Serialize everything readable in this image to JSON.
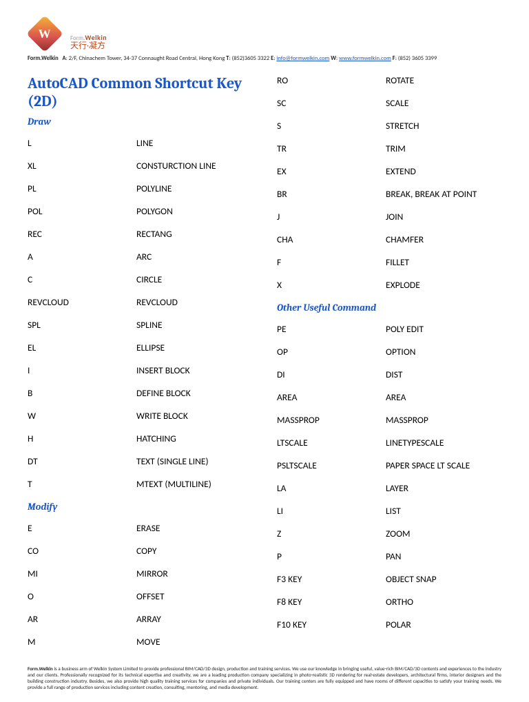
{
  "brand": {
    "company": "Form.Welkin",
    "logo_text_top": "Form.",
    "logo_text_mid": "Welkin",
    "logo_text_cn": "天行·凝方"
  },
  "address_line": {
    "pre": "Form.Welkin",
    "a_label": "A",
    "a": ": 2/F, Chinachem Tower, 34-37 Connaught Road Central, Hong Kong ",
    "t_label": "T",
    "t": ": (852)3605 3322 ",
    "e_label": "E",
    "e_pre": ": ",
    "e_link": "info@formwelkin.com",
    "w_label": " W",
    "w_pre": ": ",
    "w_link": "www.formwelkin.com",
    "f_label": " F",
    "f": ": (852) 3605 3399"
  },
  "title": "AutoCAD Common Shortcut Key (2D)",
  "sections": {
    "draw": "Draw",
    "modify": "Modify",
    "other": "Other Useful Command"
  },
  "draw": [
    {
      "k": "L",
      "v": "LINE"
    },
    {
      "k": "XL",
      "v": "CONSTURCTION LINE"
    },
    {
      "k": "PL",
      "v": "POLYLINE"
    },
    {
      "k": "POL",
      "v": "POLYGON"
    },
    {
      "k": "REC",
      "v": "RECTANG"
    },
    {
      "k": "A",
      "v": "ARC"
    },
    {
      "k": "C",
      "v": "CIRCLE"
    },
    {
      "k": "REVCLOUD",
      "v": "REVCLOUD"
    },
    {
      "k": "SPL",
      "v": "SPLINE"
    },
    {
      "k": "EL",
      "v": "ELLIPSE"
    },
    {
      "k": "I",
      "v": "INSERT BLOCK"
    },
    {
      "k": "B",
      "v": "DEFINE BLOCK"
    },
    {
      "k": "W",
      "v": "WRITE BLOCK"
    },
    {
      "k": "H",
      "v": "HATCHING"
    },
    {
      "k": "DT",
      "v": "TEXT (SINGLE LINE)"
    },
    {
      "k": "T",
      "v": "MTEXT (MULTILINE)"
    }
  ],
  "modify": [
    {
      "k": "E",
      "v": "ERASE"
    },
    {
      "k": "CO",
      "v": "COPY"
    },
    {
      "k": "MI",
      "v": "MIRROR"
    },
    {
      "k": "O",
      "v": "OFFSET"
    },
    {
      "k": "AR",
      "v": "ARRAY"
    },
    {
      "k": "M",
      "v": "MOVE"
    },
    {
      "k": "RO",
      "v": "ROTATE"
    },
    {
      "k": "SC",
      "v": "SCALE"
    },
    {
      "k": "S",
      "v": "STRETCH"
    },
    {
      "k": "TR",
      "v": "TRIM"
    },
    {
      "k": "EX",
      "v": "EXTEND"
    },
    {
      "k": "BR",
      "v": "BREAK, BREAK AT POINT"
    },
    {
      "k": "J",
      "v": "JOIN"
    },
    {
      "k": "CHA",
      "v": "CHAMFER"
    },
    {
      "k": "F",
      "v": "FILLET"
    },
    {
      "k": "X",
      "v": "EXPLODE"
    }
  ],
  "other": [
    {
      "k": "PE",
      "v": "POLY EDIT"
    },
    {
      "k": "OP",
      "v": "OPTION"
    },
    {
      "k": "DI",
      "v": "DIST"
    },
    {
      "k": "AREA",
      "v": "AREA"
    },
    {
      "k": "MASSPROP",
      "v": "MASSPROP"
    },
    {
      "k": "LTSCALE",
      "v": "LINETYPESCALE"
    },
    {
      "k": "PSLTSCALE",
      "v": "PAPER SPACE LT SCALE"
    },
    {
      "k": "LA",
      "v": "LAYER"
    },
    {
      "k": "LI",
      "v": "LIST"
    },
    {
      "k": "Z",
      "v": "ZOOM"
    },
    {
      "k": "P",
      "v": "PAN"
    },
    {
      "k": "F3 KEY",
      "v": "OBJECT SNAP"
    },
    {
      "k": "F8 KEY",
      "v": "ORTHO"
    },
    {
      "k": "F10 KEY",
      "v": "POLAR"
    }
  ],
  "footer": {
    "lead": "Form.Welkin",
    "body": " is a business arm of Welkin System Limited to provide professional BIM/CAD/3D design, production and training services. We use our knowledge in bringing useful, value-rich BIM/CAD/3D contents and experiences to the industry and our clients. Professionally recognized for its technical expertise and creativity, we are a leading production company specializing in photo-realistic 3D rendering for real-estate developers, architectural firms, interior designers and the building construction industry. Besides, we also provide high quality training services for companies and private individuals. Our training centers are fully equipped and have rooms of different capacities to satisfy your training needs. We provide a full range of production services including content creation, consulting, mentoring, and media development."
  }
}
